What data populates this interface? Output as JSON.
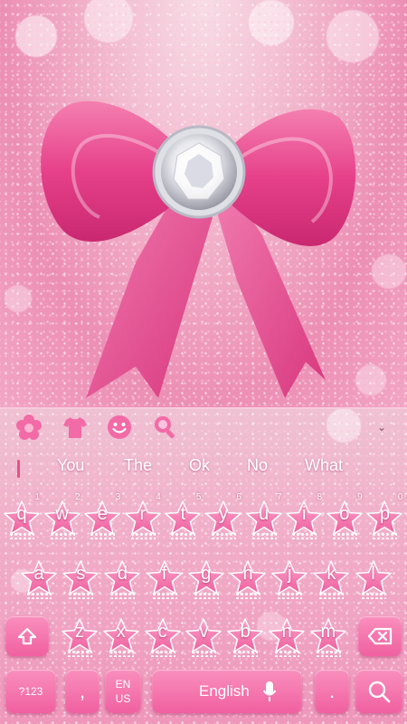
{
  "toolbar": {
    "icons": [
      "flower-icon",
      "shirt-icon",
      "smiley-icon",
      "search-icon"
    ],
    "collapse_icon": "chevron-down-icon"
  },
  "suggestions": [
    "You",
    "The",
    "Ok",
    "No",
    "What"
  ],
  "keyboard": {
    "row1": [
      {
        "letter": "q",
        "hint": "1"
      },
      {
        "letter": "w",
        "hint": "2"
      },
      {
        "letter": "e",
        "hint": "3"
      },
      {
        "letter": "r",
        "hint": "4"
      },
      {
        "letter": "t",
        "hint": "5"
      },
      {
        "letter": "y",
        "hint": "6"
      },
      {
        "letter": "u",
        "hint": "7"
      },
      {
        "letter": "i",
        "hint": "8"
      },
      {
        "letter": "o",
        "hint": "9"
      },
      {
        "letter": "p",
        "hint": "0"
      }
    ],
    "row2": [
      "a",
      "s",
      "d",
      "f",
      "g",
      "h",
      "j",
      "k",
      "l"
    ],
    "row3": [
      "z",
      "x",
      "c",
      "v",
      "b",
      "n",
      "m"
    ],
    "numbers_label": "?123",
    "comma_label": ",",
    "lang_line1": "EN",
    "lang_line2": "US",
    "space_label": "English",
    "period_label": ".",
    "shift_icon": "shift-arrow-icon",
    "backspace_icon": "backspace-icon",
    "mic_icon": "microphone-icon",
    "search_icon": "search-icon"
  },
  "colors": {
    "key_pink": "#f060a0",
    "key_pink_light": "#f98fbd",
    "background_pink": "#f2a6c6",
    "bow_pink": "#e83f86",
    "cursor_pink": "#e8508c"
  }
}
